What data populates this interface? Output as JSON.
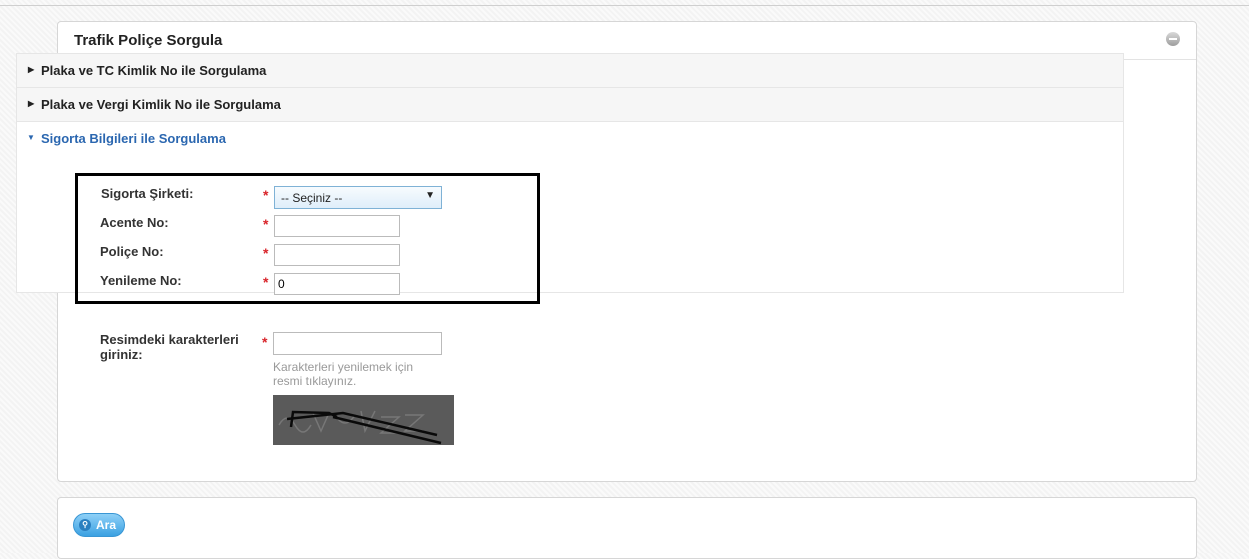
{
  "panel": {
    "title": "Trafik Poliçe Sorgula"
  },
  "accordion": {
    "items": [
      {
        "label": "Plaka ve TC Kimlik No ile Sorgulama",
        "expanded": false
      },
      {
        "label": "Plaka ve Vergi Kimlik No ile Sorgulama",
        "expanded": false
      },
      {
        "label": "Sigorta Bilgileri ile Sorgulama",
        "expanded": true
      }
    ]
  },
  "form": {
    "required_mark": "*",
    "sigorta_sirketi": {
      "label": "Sigorta Şirketi:",
      "selected": "-- Seçiniz --"
    },
    "acente_no": {
      "label": "Acente No:",
      "value": ""
    },
    "police_no": {
      "label": "Poliçe No:",
      "value": ""
    },
    "yenileme_no": {
      "label": "Yenileme No:",
      "value": "0"
    }
  },
  "captcha": {
    "label_line1": "Resimdeki karakterleri",
    "label_line2": "giriniz:",
    "value": "",
    "hint": "Karakterleri yenilemek için resmi tıklayınız."
  },
  "actions": {
    "search_label": "Ara"
  },
  "icons": {
    "collapse": "minus-circle-icon",
    "collapsed": "caret-right-icon",
    "expanded": "caret-down-icon",
    "search": "search-icon"
  },
  "colors": {
    "accent": "#2b67b0",
    "required": "#d9252b",
    "button": "#3ba1e2",
    "highlight_border": "#000000"
  }
}
